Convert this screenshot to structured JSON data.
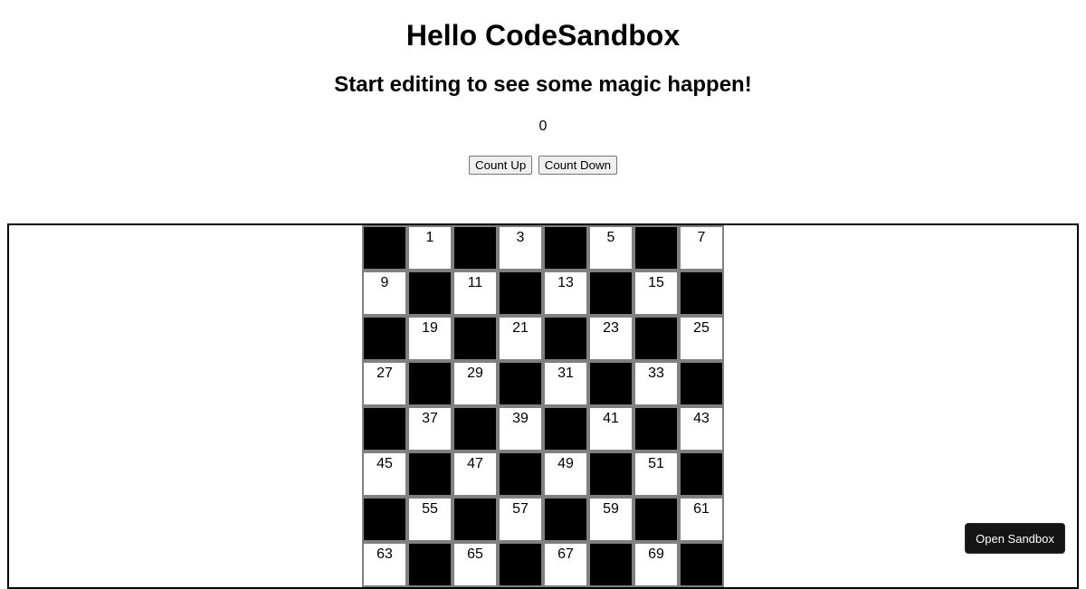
{
  "header": {
    "title": "Hello CodeSandbox",
    "subtitle": "Start editing to see some magic happen!"
  },
  "counter": {
    "value": "0",
    "count_up_label": "Count Up",
    "count_down_label": "Count Down"
  },
  "board": {
    "rows": 8,
    "cols": 8,
    "dark_color": "#000000",
    "light_color": "#ffffff",
    "border_color": "#808080",
    "cells": [
      [
        "",
        "1",
        "",
        "3",
        "",
        "5",
        "",
        "7"
      ],
      [
        "9",
        "",
        "11",
        "",
        "13",
        "",
        "15",
        ""
      ],
      [
        "",
        "19",
        "",
        "21",
        "",
        "23",
        "",
        "25"
      ],
      [
        "27",
        "",
        "29",
        "",
        "31",
        "",
        "33",
        ""
      ],
      [
        "",
        "37",
        "",
        "39",
        "",
        "41",
        "",
        "43"
      ],
      [
        "45",
        "",
        "47",
        "",
        "49",
        "",
        "51",
        ""
      ],
      [
        "",
        "55",
        "",
        "57",
        "",
        "59",
        "",
        "61"
      ],
      [
        "63",
        "",
        "65",
        "",
        "67",
        "",
        "69",
        ""
      ]
    ]
  },
  "open_sandbox_label": "Open Sandbox"
}
